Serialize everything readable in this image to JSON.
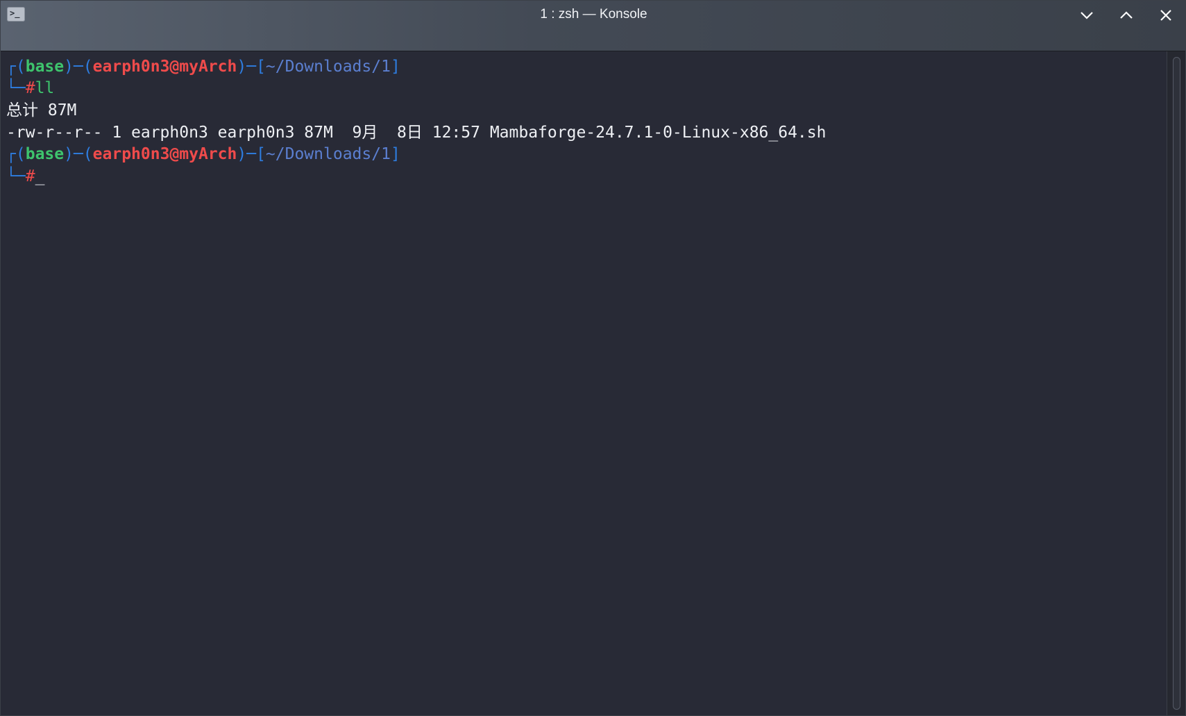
{
  "window": {
    "title": "1 : zsh — Konsole",
    "icon": "terminal-icon",
    "controls": [
      "chevron-down-icon",
      "chevron-up-icon",
      "close-icon"
    ]
  },
  "terminal": {
    "colors": {
      "background": "#282a36",
      "bracket": "#2e7de0",
      "env": "#3ec46d",
      "user_host": "#ef4b4b",
      "path": "#5b7fd0",
      "text": "#eef0f4"
    },
    "prompt1": {
      "corner": "┌",
      "open1": "(",
      "env": "base",
      "sep1": ")─(",
      "user_host": "earph0n3@myArch",
      "sep2": ")─[",
      "path": "~/Downloads/1",
      "close": "]",
      "corner2": "└─",
      "hash": "#",
      "command": "ll"
    },
    "output": {
      "total": "总计 87M",
      "file_line": "-rw-r--r-- 1 earph0n3 earph0n3 87M  9月  8日 12:57 Mambaforge-24.7.1-0-Linux-x86_64.sh"
    },
    "prompt2": {
      "corner": "┌",
      "open1": "(",
      "env": "base",
      "sep1": ")─(",
      "user_host": "earph0n3@myArch",
      "sep2": ")─[",
      "path": "~/Downloads/1",
      "close": "]",
      "corner2": "└─",
      "hash": "#",
      "cursor": "_"
    }
  }
}
